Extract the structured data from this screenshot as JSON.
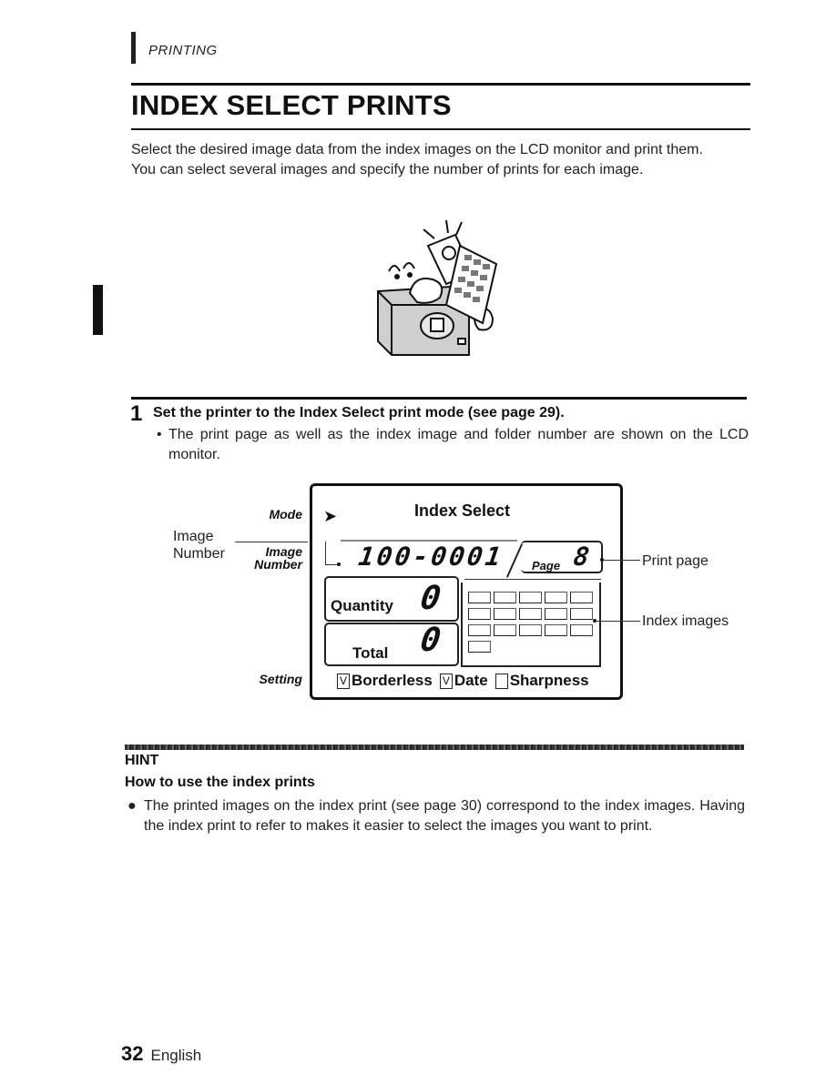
{
  "header": {
    "section": "PRINTING",
    "title": "INDEX SELECT PRINTS"
  },
  "intro": {
    "paragraphs": [
      "Select the desired image data from the index images on the LCD monitor and print them.",
      "You can select several images and specify the number of prints for each image."
    ]
  },
  "illustration": {
    "icon": "printer-with-index-print-illustration"
  },
  "step": {
    "number": "1",
    "title": "Set the printer to the Index Select print mode (see page 29).",
    "bullet_symbol": "•",
    "bullet": "The print page as well as the index image and folder number are shown on the LCD monitor."
  },
  "lcd": {
    "side_labels": {
      "mode": "Mode",
      "image_number_line1": "Image",
      "image_number_line2": "Number",
      "setting": "Setting"
    },
    "callouts": {
      "image_number_line1": "Image",
      "image_number_line2": "Number",
      "print_page": "Print page",
      "index_images": "Index images"
    },
    "mode_arrow": "➤",
    "mode_value": "Index Select",
    "image_number": "100-0001",
    "page_label": "Page",
    "page_value": "8",
    "quantity_label": "Quantity",
    "quantity_value": "0",
    "total_label": "Total",
    "total_value": "0",
    "index_image_count": 16,
    "settings": [
      {
        "label": "Borderless",
        "checked": true,
        "mark": "V"
      },
      {
        "label": "Date",
        "checked": true,
        "mark": "V"
      },
      {
        "label": "Sharpness",
        "checked": false,
        "mark": ""
      }
    ]
  },
  "hint": {
    "title": "HINT",
    "subtitle": "How to use the index prints",
    "bullet_symbol": "●",
    "body": "The printed images on the index print (see page 30) correspond to the index images. Having the index print to refer to makes it easier to select the images you want to print."
  },
  "footer": {
    "page_number": "32",
    "language": "English"
  }
}
